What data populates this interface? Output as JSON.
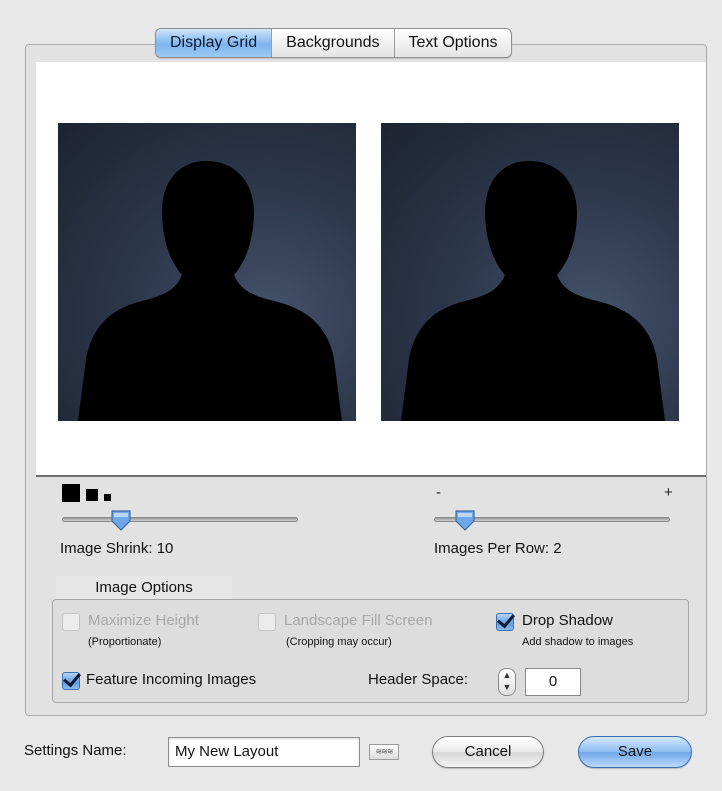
{
  "tabs": [
    {
      "label": "Display Grid",
      "active": true
    },
    {
      "label": "Backgrounds",
      "active": false
    },
    {
      "label": "Text Options",
      "active": false
    }
  ],
  "preview": {
    "images": [
      {
        "icon": "person-silhouette-icon"
      },
      {
        "icon": "person-silhouette-icon"
      }
    ]
  },
  "sliders": {
    "shrink": {
      "label": "Image Shrink: 10",
      "value": 10,
      "fraction": 0.25
    },
    "per_row": {
      "label": "Images Per Row: 2",
      "value": 2,
      "fraction": 0.13,
      "min_label": "-",
      "max_label": "+"
    }
  },
  "image_options": {
    "title": "Image Options",
    "maximize_height": {
      "label": "Maximize Height",
      "sub": "(Proportionate)",
      "checked": false,
      "enabled": false
    },
    "landscape_fill": {
      "label": "Landscape Fill Screen",
      "sub": "(Cropping may occur)",
      "checked": false,
      "enabled": false
    },
    "drop_shadow": {
      "label": "Drop Shadow",
      "sub": "Add shadow to images",
      "checked": true,
      "enabled": true
    },
    "feature_incoming": {
      "label": "Feature Incoming Images",
      "checked": true,
      "enabled": true
    },
    "header_space": {
      "label": "Header Space:",
      "value": "0"
    }
  },
  "footer": {
    "settings_name_label": "Settings Name:",
    "settings_name_value": "My New Layout",
    "cancel_label": "Cancel",
    "save_label": "Save"
  },
  "colors": {
    "accent": "#7fb4ee",
    "photo_bg": "#2d384b"
  }
}
